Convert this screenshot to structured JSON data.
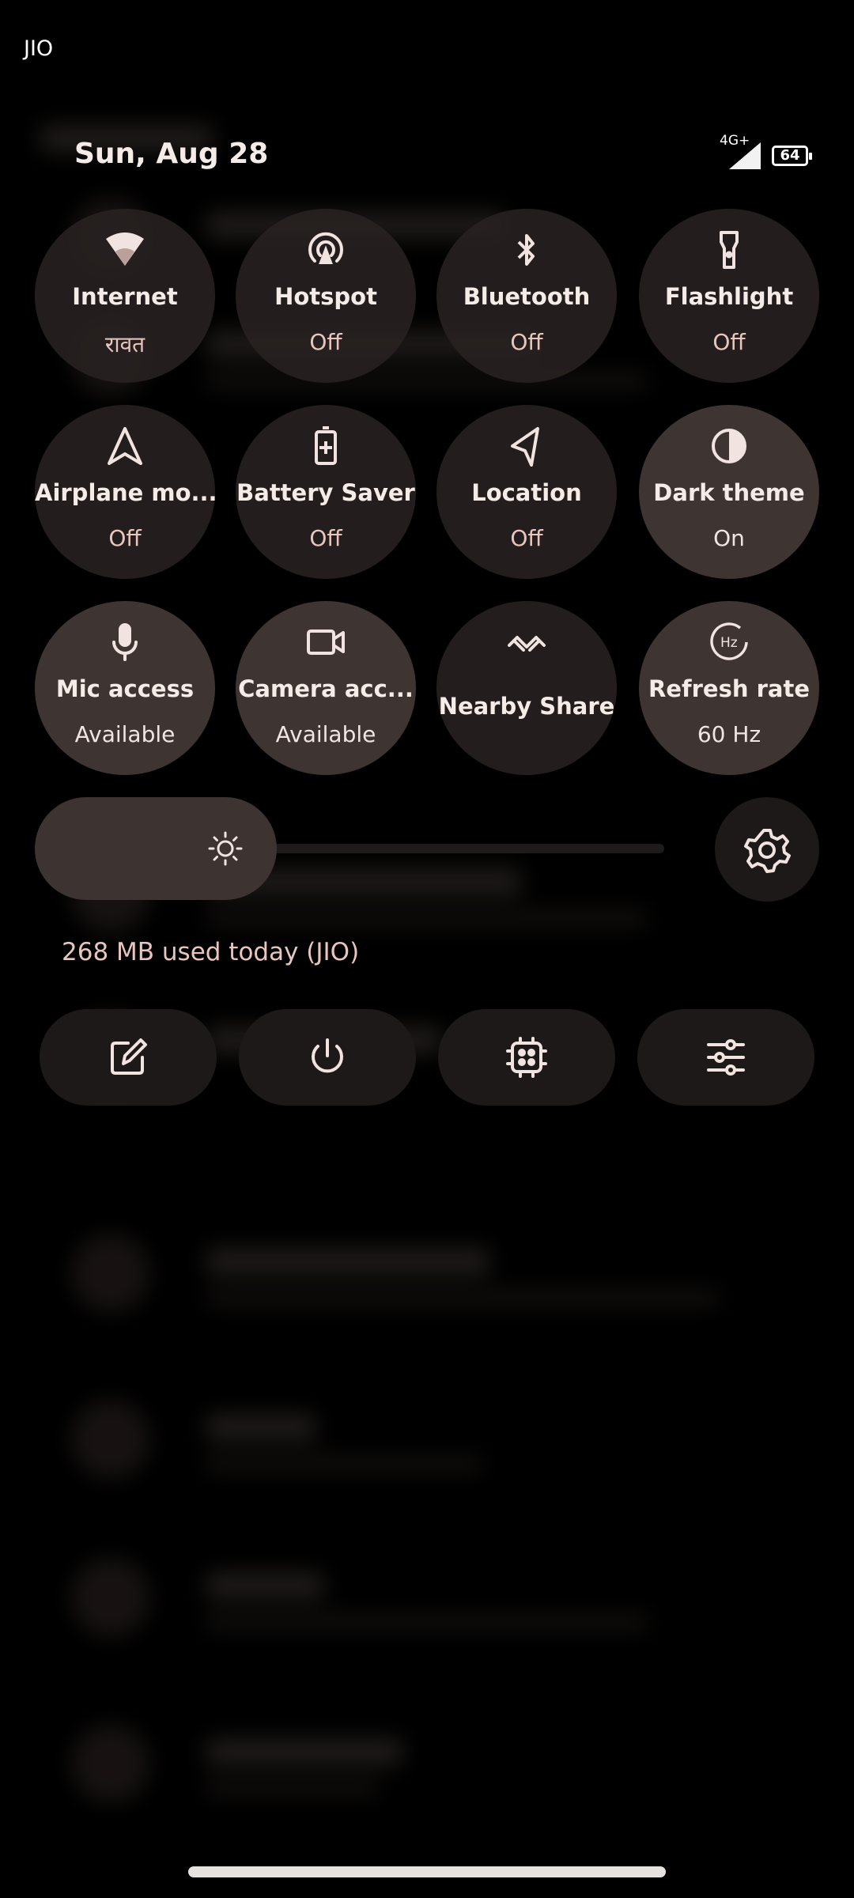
{
  "status_bar": {
    "carrier": "JIO",
    "network": "4G+",
    "battery": "64"
  },
  "header": {
    "date": "Sun, Aug 28"
  },
  "tiles": [
    {
      "label": "Internet",
      "state": "रावत",
      "icon": "wifi-icon",
      "active": false
    },
    {
      "label": "Hotspot",
      "state": "Off",
      "icon": "hotspot-icon",
      "active": false
    },
    {
      "label": "Bluetooth",
      "state": "Off",
      "icon": "bluetooth-icon",
      "active": false
    },
    {
      "label": "Flashlight",
      "state": "Off",
      "icon": "flashlight-icon",
      "active": false
    },
    {
      "label": "Airplane mo...",
      "state": "Off",
      "icon": "airplane-icon",
      "active": false
    },
    {
      "label": "Battery Saver",
      "state": "Off",
      "icon": "battery-saver-icon",
      "active": false
    },
    {
      "label": "Location",
      "state": "Off",
      "icon": "location-icon",
      "active": false
    },
    {
      "label": "Dark theme",
      "state": "On",
      "icon": "dark-theme-icon",
      "active": true
    },
    {
      "label": "Mic access",
      "state": "Available",
      "icon": "mic-icon",
      "active": true
    },
    {
      "label": "Camera acc...",
      "state": "Available",
      "icon": "camera-icon",
      "active": true
    },
    {
      "label": "Nearby Share",
      "state": "",
      "icon": "nearby-share-icon",
      "active": false
    },
    {
      "label": "Refresh rate",
      "state": "60 Hz",
      "icon": "refresh-rate-icon",
      "active": true
    }
  ],
  "brightness": {
    "level": 0.25,
    "icon": "brightness-icon"
  },
  "data_usage": "268 MB used today (JIO)",
  "bottom_actions": [
    {
      "name": "edit",
      "icon": "edit-icon"
    },
    {
      "name": "power",
      "icon": "power-icon"
    },
    {
      "name": "device-controls",
      "icon": "chip-icon"
    },
    {
      "name": "adjust",
      "icon": "sliders-icon"
    }
  ],
  "colors": {
    "tile_bg": "#282221",
    "tile_active_bg": "#3e3432",
    "accent_text": "#e8c6bf"
  }
}
